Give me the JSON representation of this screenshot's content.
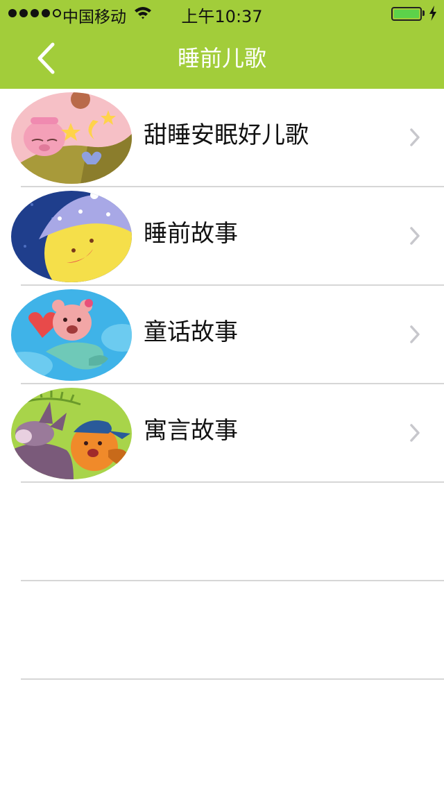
{
  "status_bar": {
    "carrier": "中国移动",
    "time": "上午10:37",
    "signal_bars": 4,
    "battery_level": 1.0
  },
  "nav": {
    "title": "睡前儿歌",
    "back_icon": "chevron-left-icon"
  },
  "list": {
    "items": [
      {
        "label": "甜睡安眠好儿歌",
        "thumbnail": "sleeping-pig-thumbnail"
      },
      {
        "label": "睡前故事",
        "thumbnail": "sleepy-moon-thumbnail"
      },
      {
        "label": "童话故事",
        "thumbnail": "mermaid-bear-thumbnail"
      },
      {
        "label": "寓言故事",
        "thumbnail": "donkey-squirrel-thumbnail"
      }
    ]
  },
  "colors": {
    "header": "#a2cd3a",
    "separator": "#d6d6d6",
    "chevron": "#c7c7cc",
    "battery": "#5cd24a"
  }
}
